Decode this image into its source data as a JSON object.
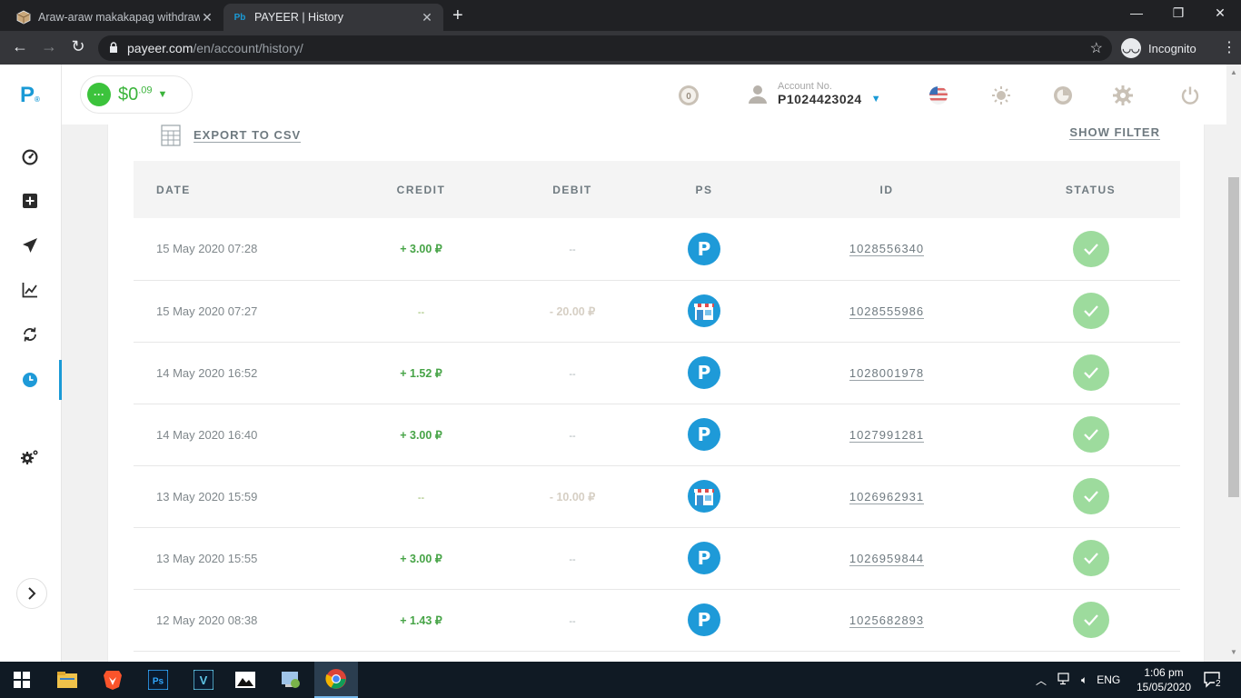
{
  "browser": {
    "tabs": [
      {
        "title": "Araw-araw makakapag withdraw",
        "active": false
      },
      {
        "title": "PAYEER | History",
        "active": true
      }
    ],
    "url_host": "payeer.com",
    "url_path": "/en/account/history/",
    "incognito_label": "Incognito"
  },
  "header": {
    "balance_main": "$0",
    "balance_cents": ".09",
    "account_label": "Account No.",
    "account_number": "P1024423024"
  },
  "actions": {
    "export_label": "EXPORT TO CSV",
    "filter_label": "SHOW FILTER"
  },
  "table": {
    "headers": {
      "date": "DATE",
      "credit": "CREDIT",
      "debit": "DEBIT",
      "ps": "PS",
      "id": "ID",
      "status": "STATUS"
    },
    "rows": [
      {
        "date": "15 May 2020 07:28",
        "credit": "+ 3.00 ₽",
        "debit": "--",
        "ps": "payeer",
        "id": "1028556340"
      },
      {
        "date": "15 May 2020 07:27",
        "credit": "--",
        "debit": "- 20.00 ₽",
        "ps": "shop",
        "id": "1028555986"
      },
      {
        "date": "14 May 2020 16:52",
        "credit": "+ 1.52 ₽",
        "debit": "--",
        "ps": "payeer",
        "id": "1028001978"
      },
      {
        "date": "14 May 2020 16:40",
        "credit": "+ 3.00 ₽",
        "debit": "--",
        "ps": "payeer",
        "id": "1027991281"
      },
      {
        "date": "13 May 2020 15:59",
        "credit": "--",
        "debit": "- 10.00 ₽",
        "ps": "shop",
        "id": "1026962931"
      },
      {
        "date": "13 May 2020 15:55",
        "credit": "+ 3.00 ₽",
        "debit": "--",
        "ps": "payeer",
        "id": "1026959844"
      },
      {
        "date": "12 May 2020 08:38",
        "credit": "+ 1.43 ₽",
        "debit": "--",
        "ps": "payeer",
        "id": "1025682893"
      }
    ]
  },
  "taskbar": {
    "language": "ENG",
    "time": "1:06 pm",
    "date": "15/05/2020",
    "notifications": "2"
  },
  "colors": {
    "accent_blue": "#1e9ad8",
    "credit_green": "#47a447",
    "status_green": "#9ddb9d"
  }
}
